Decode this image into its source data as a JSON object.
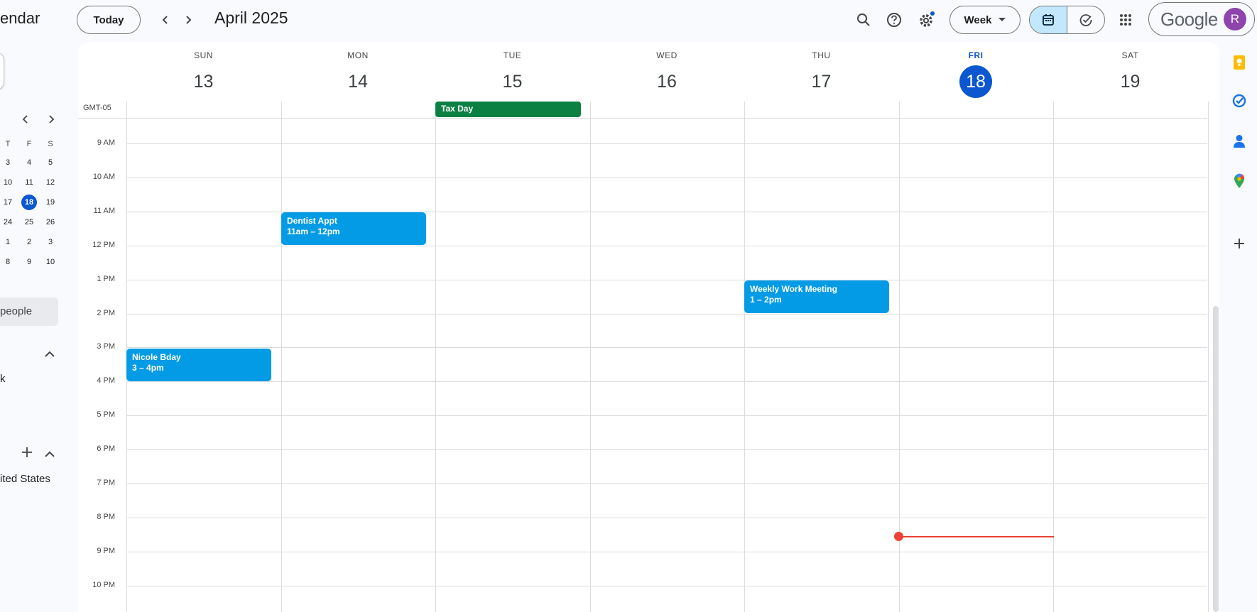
{
  "app": {
    "title": "endar"
  },
  "header": {
    "today_label": "Today",
    "month_label": "April 2025",
    "view_label": "Week",
    "account_logo": "Google",
    "avatar_letter": "R"
  },
  "mini_calendar": {
    "headers": [
      "T",
      "F",
      "S"
    ],
    "rows": [
      [
        "3",
        "4",
        "5"
      ],
      [
        "10",
        "11",
        "12"
      ],
      [
        "17",
        "18",
        "19"
      ],
      [
        "24",
        "25",
        "26"
      ],
      [
        "1",
        "2",
        "3"
      ],
      [
        "8",
        "9",
        "10"
      ]
    ],
    "selected": "18"
  },
  "sidebar": {
    "people_label": "people",
    "section_text": "k",
    "other_item": "ited States"
  },
  "week": {
    "timezone": "GMT-05",
    "days": [
      {
        "name": "SUN",
        "num": "13"
      },
      {
        "name": "MON",
        "num": "14"
      },
      {
        "name": "TUE",
        "num": "15"
      },
      {
        "name": "WED",
        "num": "16"
      },
      {
        "name": "THU",
        "num": "17"
      },
      {
        "name": "FRI",
        "num": "18"
      },
      {
        "name": "SAT",
        "num": "19"
      }
    ],
    "today_index": 5,
    "hours": [
      "9 AM",
      "10 AM",
      "11 AM",
      "12 PM",
      "1 PM",
      "2 PM",
      "3 PM",
      "4 PM",
      "5 PM",
      "6 PM",
      "7 PM",
      "8 PM",
      "9 PM",
      "10 PM"
    ]
  },
  "events": {
    "tax_day": {
      "title": "Tax Day"
    },
    "dentist": {
      "title": "Dentist Appt",
      "time": "11am – 12pm"
    },
    "meeting": {
      "title": "Weekly Work Meeting",
      "time": "1 – 2pm"
    },
    "bday": {
      "title": "Nicole Bday",
      "time": "3 – 4pm"
    }
  },
  "colors": {
    "accent": "#0b57d0",
    "event_blue": "#039be5",
    "event_green": "#0b8043",
    "now_line": "#ea4335"
  },
  "icons": [
    "search-icon",
    "help-icon",
    "settings-icon",
    "calendar-view-icon",
    "tasks-view-icon",
    "apps-grid-icon",
    "keep-icon",
    "tasks-icon",
    "contacts-icon",
    "maps-icon",
    "add-icon"
  ]
}
